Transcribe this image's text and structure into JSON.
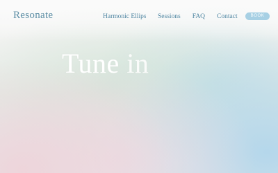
{
  "brand": {
    "logo": "Resonate"
  },
  "nav": {
    "items": [
      "Harmonic Ellipse",
      "Sessions",
      "FAQ",
      "Contact"
    ],
    "book_label": "BOOK"
  },
  "hero": {
    "word1": "Tune",
    "word2": "in"
  },
  "colors": {
    "brand": "#5e8fa6",
    "nav_text": "#4f86a2",
    "book_button": "#a7d0e4",
    "hero_text": "#ffffff"
  }
}
